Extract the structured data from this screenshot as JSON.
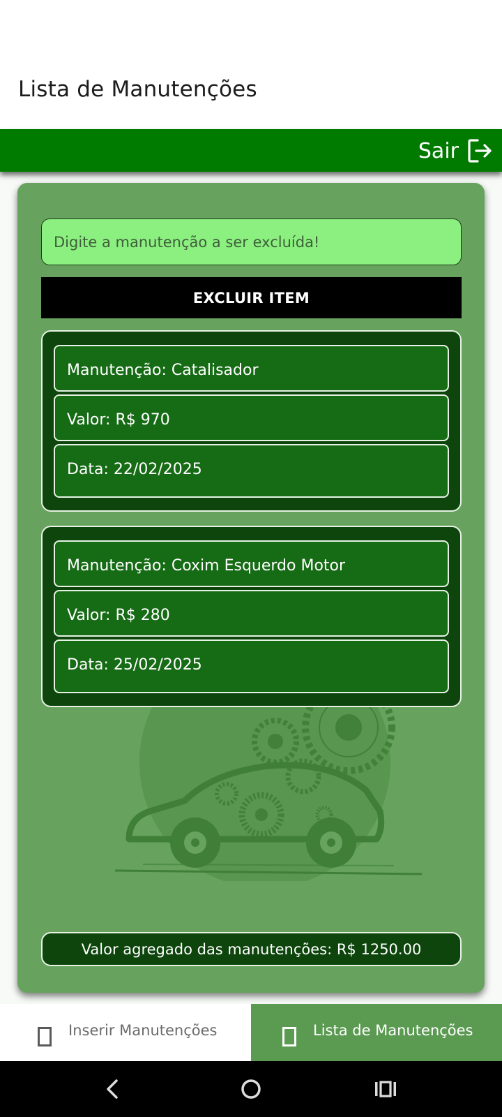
{
  "header": {
    "title": "Lista de Manutenções"
  },
  "top_bar": {
    "logout_label": "Sair",
    "logout_icon": "logout-icon",
    "color": "#007b00"
  },
  "delete_form": {
    "placeholder": "Digite a manutenção a ser excluída!",
    "value": "",
    "button_label": "EXCLUIR ITEM"
  },
  "maintenances": [
    {
      "name": "Manutenção: Catalisador",
      "value": "Valor: R$ 970",
      "date": "Data: 22/02/2025"
    },
    {
      "name": "Manutenção: Coxim Esquerdo Motor",
      "value": "Valor: R$ 280",
      "date": "Data: 25/02/2025"
    }
  ],
  "total": {
    "label": "Valor agregado das manutenções: R$ 1250.00"
  },
  "bottom_nav": {
    "tabs": [
      {
        "label": "Inserir Manutenções",
        "icon": "tab-icon",
        "active": false
      },
      {
        "label": "Lista de Manutenções",
        "icon": "tab-icon",
        "active": true
      }
    ],
    "active_color": "#5a9a51"
  },
  "system_nav": {
    "buttons": [
      "back-icon",
      "home-icon",
      "recents-icon"
    ]
  },
  "colors": {
    "card_bg": "#67a35e",
    "item_bg": "#0d450c",
    "field_bg": "#166b15",
    "input_bg": "#8bf07f"
  }
}
